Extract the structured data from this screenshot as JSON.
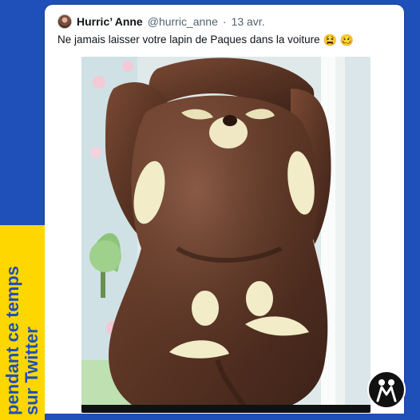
{
  "tweet": {
    "display_name": "Hurric’ Anne",
    "handle": "@hurric_anne",
    "separator": "·",
    "date": "13 avr.",
    "text": "Ne jamais laisser votre lapin de Paques dans la voiture",
    "emojis": [
      "😫",
      "🥴"
    ]
  },
  "side_banner": {
    "line1": "pendant ce temps",
    "line2": "sur Twitter"
  },
  "colors": {
    "background_blue": "#1f4fb8",
    "banner_yellow": "#ffd700"
  },
  "icons": [
    "avatar",
    "logo-icon"
  ]
}
